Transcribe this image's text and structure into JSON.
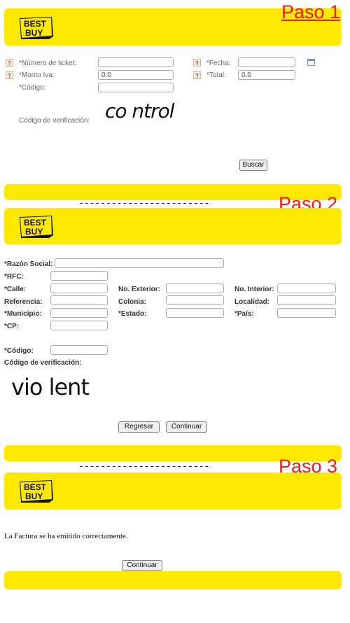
{
  "steps": {
    "paso1": "Paso 1",
    "paso2": "Paso 2",
    "paso3": "Paso 3",
    "separator": "------------------------"
  },
  "logo": {
    "line1": "BEST",
    "line2": "BUY"
  },
  "step1": {
    "ticket_label": "*Número de ticket:",
    "fecha_label": "*Fecha:",
    "monto_label": "*Monto Iva:",
    "monto_value": "0.0",
    "total_label": "*Total:",
    "total_value": "0.0",
    "codigo_label": "*Código:",
    "verif_label": "Código de verificación:",
    "captcha": "co ntrol",
    "search_button": "Buscar"
  },
  "step2": {
    "razon_label": "*Razón Social:",
    "rfc_label": "*RFC:",
    "calle_label": "*Calle:",
    "no_ext_label": "No. Exterior:",
    "no_int_label": "No. Interior:",
    "referencia_label": "Referencia:",
    "colonia_label": "Colonia:",
    "localidad_label": "Localidad:",
    "municipio_label": "*Municipio:",
    "estado_label": "*Estado:",
    "pais_label": "*País:",
    "cp_label": "*CP:",
    "codigo_label": "*Código:",
    "verif_label": "Código de verificación:",
    "captcha": "vio lent",
    "back_button": "Regresar",
    "continue_button": "Continuar"
  },
  "step3": {
    "message": "La Factura se ha emitido correctamente.",
    "continue_button": "Continuar"
  },
  "colors": {
    "brand_yellow": "#fde800",
    "step_red": "#e62020"
  }
}
